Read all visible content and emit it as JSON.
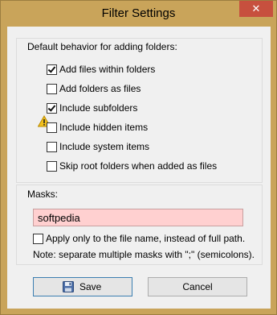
{
  "window": {
    "title": "Filter Settings",
    "close_glyph": "✕"
  },
  "defaults": {
    "legend": "Default behavior for adding folders:",
    "options": [
      {
        "label": "Add files within folders",
        "checked": true
      },
      {
        "label": "Add folders as files",
        "checked": false,
        "warning_icon": "warning-icon"
      },
      {
        "label": "Include subfolders",
        "checked": true
      },
      {
        "label": "Include hidden items",
        "checked": false
      },
      {
        "label": "Include system items",
        "checked": false
      },
      {
        "label": "Skip root folders when added as files",
        "checked": false
      }
    ]
  },
  "masks": {
    "legend": "Masks:",
    "value": "softpedia",
    "apply_filename_label": "Apply only to the file name, instead of full path.",
    "apply_filename_checked": false,
    "note": "Note: separate multiple masks with \";\" (semicolons)."
  },
  "buttons": {
    "save_label": "Save",
    "save_icon": "floppy-disk-icon",
    "cancel_label": "Cancel"
  },
  "colors": {
    "titlebar": "#c9a45a",
    "close_button": "#c7503e",
    "mask_field_bg": "#ffd0d0",
    "default_button_border": "#3c7fb1"
  }
}
